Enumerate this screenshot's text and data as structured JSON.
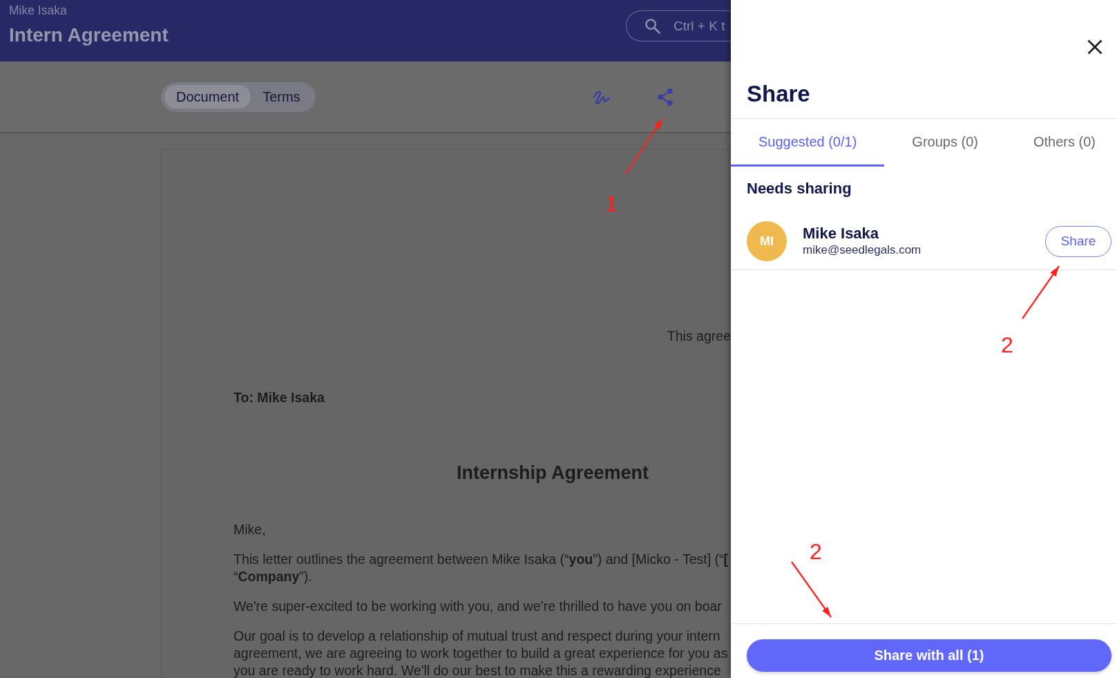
{
  "header": {
    "user_name": "Mike Isaka",
    "title": "Intern Agreement",
    "search": {
      "placeholder": "Ctrl + K t"
    }
  },
  "toolbar": {
    "view_tabs": [
      {
        "label": "Document",
        "selected": true
      },
      {
        "label": "Terms",
        "selected": false
      }
    ]
  },
  "document": {
    "date_line": "This agree",
    "addressee": "To: Mike Isaka",
    "heading": "Internship Agreement",
    "paragraphs": [
      {
        "lines": [
          "Mike,"
        ]
      },
      {
        "lines": [
          "This letter outlines the agreement between Mike Isaka (“**you**”) and [Micko - Test] (“**[**",
          "“**Company**”)."
        ]
      },
      {
        "lines": [
          "We're super-excited to be working with you, and we’re thrilled to have you on boar"
        ]
      },
      {
        "lines": [
          "Our goal is to develop a relationship of mutual trust and respect during your intern",
          "agreement, we are agreeing to work together to build a great experience for you as",
          "you are ready to work hard. We'll do our best to make this a rewarding experience"
        ]
      }
    ]
  },
  "share_panel": {
    "title": "Share",
    "tabs": [
      {
        "label": "Suggested (0/1)",
        "selected": true
      },
      {
        "label": "Groups (0)",
        "selected": false
      },
      {
        "label": "Others (0)",
        "selected": false
      }
    ],
    "section_title": "Needs sharing",
    "people": [
      {
        "initials": "MI",
        "name": "Mike Isaka",
        "email": "mike@seedlegals.com",
        "color": "#f0b94e",
        "action": "Share"
      }
    ],
    "share_all_button": "Share with all (1)"
  },
  "annotations": [
    {
      "label": "1"
    },
    {
      "label": "2"
    },
    {
      "label": "2"
    }
  ]
}
